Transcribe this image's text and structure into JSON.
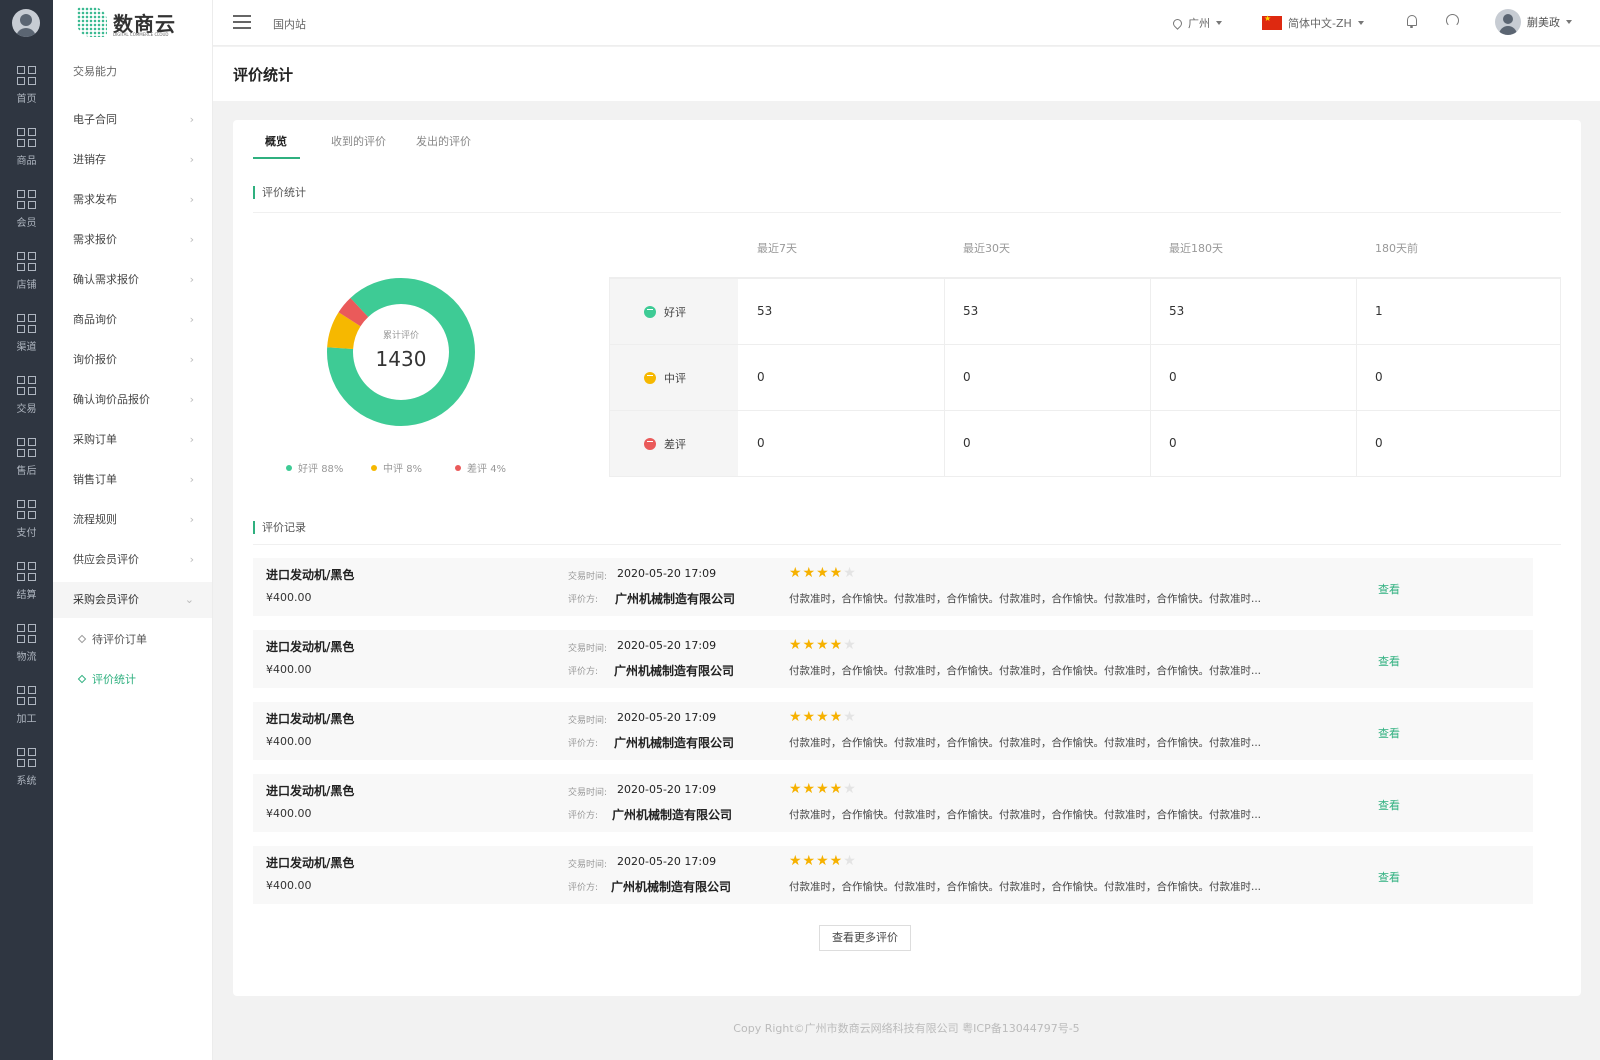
{
  "rail": {
    "items": [
      {
        "label": "首页"
      },
      {
        "label": "商品"
      },
      {
        "label": "会员"
      },
      {
        "label": "店铺"
      },
      {
        "label": "渠道"
      },
      {
        "label": "交易"
      },
      {
        "label": "售后"
      },
      {
        "label": "支付"
      },
      {
        "label": "结算"
      },
      {
        "label": "物流"
      },
      {
        "label": "加工"
      },
      {
        "label": "系统"
      }
    ]
  },
  "brand": {
    "name": "数商云",
    "sub": "DIGITAL COMMERCE CLOUD"
  },
  "sidebar": {
    "group": "交易能力",
    "items": [
      {
        "label": "电子合同"
      },
      {
        "label": "进销存"
      },
      {
        "label": "需求发布"
      },
      {
        "label": "需求报价"
      },
      {
        "label": "确认需求报价"
      },
      {
        "label": "商品询价"
      },
      {
        "label": "询价报价"
      },
      {
        "label": "确认询价品报价"
      },
      {
        "label": "采购订单"
      },
      {
        "label": "销售订单"
      },
      {
        "label": "流程规则"
      },
      {
        "label": "供应会员评价"
      },
      {
        "label": "采购会员评价"
      }
    ],
    "subitems": [
      {
        "label": "待评价订单"
      },
      {
        "label": "评价统计"
      }
    ]
  },
  "topbar": {
    "site": "国内站",
    "location": "广州",
    "language": "简体中文-ZH",
    "username": "蒯美政"
  },
  "page": {
    "title": "评价统计"
  },
  "tabs": [
    {
      "label": "概览"
    },
    {
      "label": "收到的评价"
    },
    {
      "label": "发出的评价"
    }
  ],
  "stats": {
    "section_title": "评价统计",
    "total_label": "累计评价",
    "total_value": "1430",
    "columns": [
      "最近7天",
      "最近30天",
      "最近180天",
      "180天前"
    ],
    "rows": [
      {
        "label": "好评",
        "color": "#3ecb95",
        "values": [
          "53",
          "53",
          "53",
          "1"
        ]
      },
      {
        "label": "中评",
        "color": "#f6b800",
        "values": [
          "0",
          "0",
          "0",
          "0"
        ]
      },
      {
        "label": "差评",
        "color": "#ea5a5a",
        "values": [
          "0",
          "0",
          "0",
          "0"
        ]
      }
    ],
    "legend": [
      {
        "name": "好评",
        "pct": "88%",
        "color": "#3ecb95"
      },
      {
        "name": "中评",
        "pct": "8%",
        "color": "#f6b800"
      },
      {
        "name": "差评",
        "pct": "4%",
        "color": "#ea5a5a"
      }
    ]
  },
  "chart_data": {
    "type": "pie",
    "categories": [
      "好评",
      "中评",
      "差评"
    ],
    "values": [
      88,
      8,
      4
    ],
    "title": "",
    "colors": [
      "#3ecb95",
      "#f6b800",
      "#ea5a5a"
    ],
    "legend_position": "bottom",
    "center_label": "累计评价",
    "center_value": 1430
  },
  "records": {
    "section_title": "评价记录",
    "time_label": "交易时间:",
    "reviewer_label": "评价方:",
    "view_label": "查看",
    "more_label": "查看更多评价",
    "items": [
      {
        "product": "进口发动机/黑色",
        "price": "¥400.00",
        "time": "2020-05-20 17:09",
        "reviewer": "广州机械制造有限公司",
        "stars": 4,
        "text": "付款准时，合作愉快。付款准时，合作愉快。付款准时，合作愉快。付款准时，合作愉快。付款准时..."
      },
      {
        "product": "进口发动机/黑色",
        "price": "¥400.00",
        "time": "2020-05-20 17:09",
        "reviewer": "广州机械制造有限公司",
        "stars": 4,
        "text": "付款准时，合作愉快。付款准时，合作愉快。付款准时，合作愉快。付款准时，合作愉快。付款准时..."
      },
      {
        "product": "进口发动机/黑色",
        "price": "¥400.00",
        "time": "2020-05-20 17:09",
        "reviewer": "广州机械制造有限公司",
        "stars": 4,
        "text": "付款准时，合作愉快。付款准时，合作愉快。付款准时，合作愉快。付款准时，合作愉快。付款准时..."
      },
      {
        "product": "进口发动机/黑色",
        "price": "¥400.00",
        "time": "2020-05-20 17:09",
        "reviewer": "广州机械制造有限公司",
        "stars": 4,
        "text": "付款准时，合作愉快。付款准时，合作愉快。付款准时，合作愉快。付款准时，合作愉快。付款准时..."
      },
      {
        "product": "进口发动机/黑色",
        "price": "¥400.00",
        "time": "2020-05-20 17:09",
        "reviewer": "广州机械制造有限公司",
        "stars": 4,
        "text": "付款准时，合作愉快。付款准时，合作愉快。付款准时，合作愉快。付款准时，合作愉快。付款准时..."
      }
    ]
  },
  "footer": {
    "text": "Copy Right©广州市数商云网络科技有限公司 粤ICP备13044797号-5"
  }
}
